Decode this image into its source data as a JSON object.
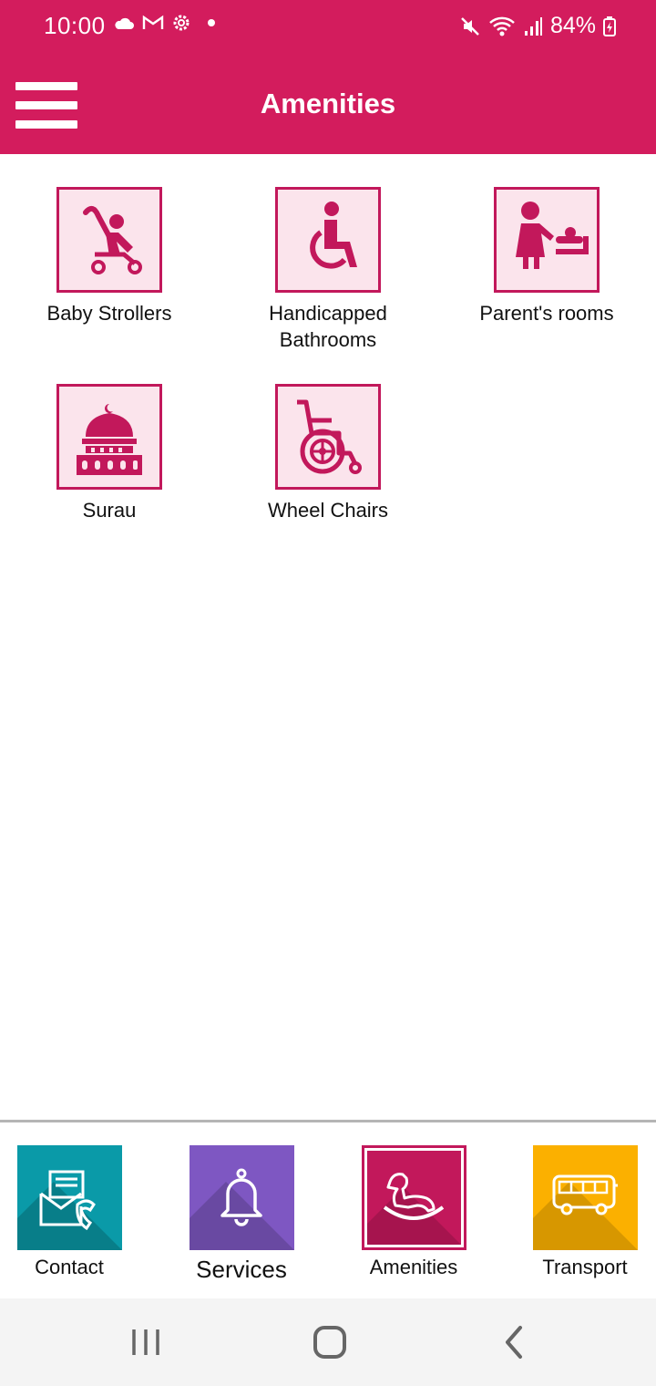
{
  "status_bar": {
    "time": "10:00",
    "battery": "84%",
    "icons": [
      "cloud-icon",
      "gmail-icon",
      "settings-icon",
      "dot-icon",
      "mute-icon",
      "wifi-icon",
      "signal-icon",
      "battery-icon"
    ]
  },
  "header": {
    "title": "Amenities",
    "menu_icon": "hamburger-icon"
  },
  "amenities": [
    {
      "label": "Baby Strollers",
      "icon": "stroller-icon"
    },
    {
      "label": "Handicapped Bathrooms",
      "icon": "accessible-icon"
    },
    {
      "label": "Parent's rooms",
      "icon": "baby-changing-icon"
    },
    {
      "label": "Surau",
      "icon": "mosque-icon"
    },
    {
      "label": "Wheel Chairs",
      "icon": "wheelchair-icon"
    }
  ],
  "bottom_nav": [
    {
      "label": "Contact",
      "icon": "contact-icon",
      "color": "#0a9aa8"
    },
    {
      "label": "Services",
      "icon": "bell-icon",
      "color": "#7e57c2"
    },
    {
      "label": "Amenities",
      "icon": "rocking-horse-icon",
      "color": "#c2185b",
      "active": true
    },
    {
      "label": "Transport",
      "icon": "bus-icon",
      "color": "#fbb000"
    }
  ],
  "colors": {
    "primary": "#d31c5d",
    "tile_bg": "#fbe4ec",
    "tile_border": "#c2185b"
  }
}
